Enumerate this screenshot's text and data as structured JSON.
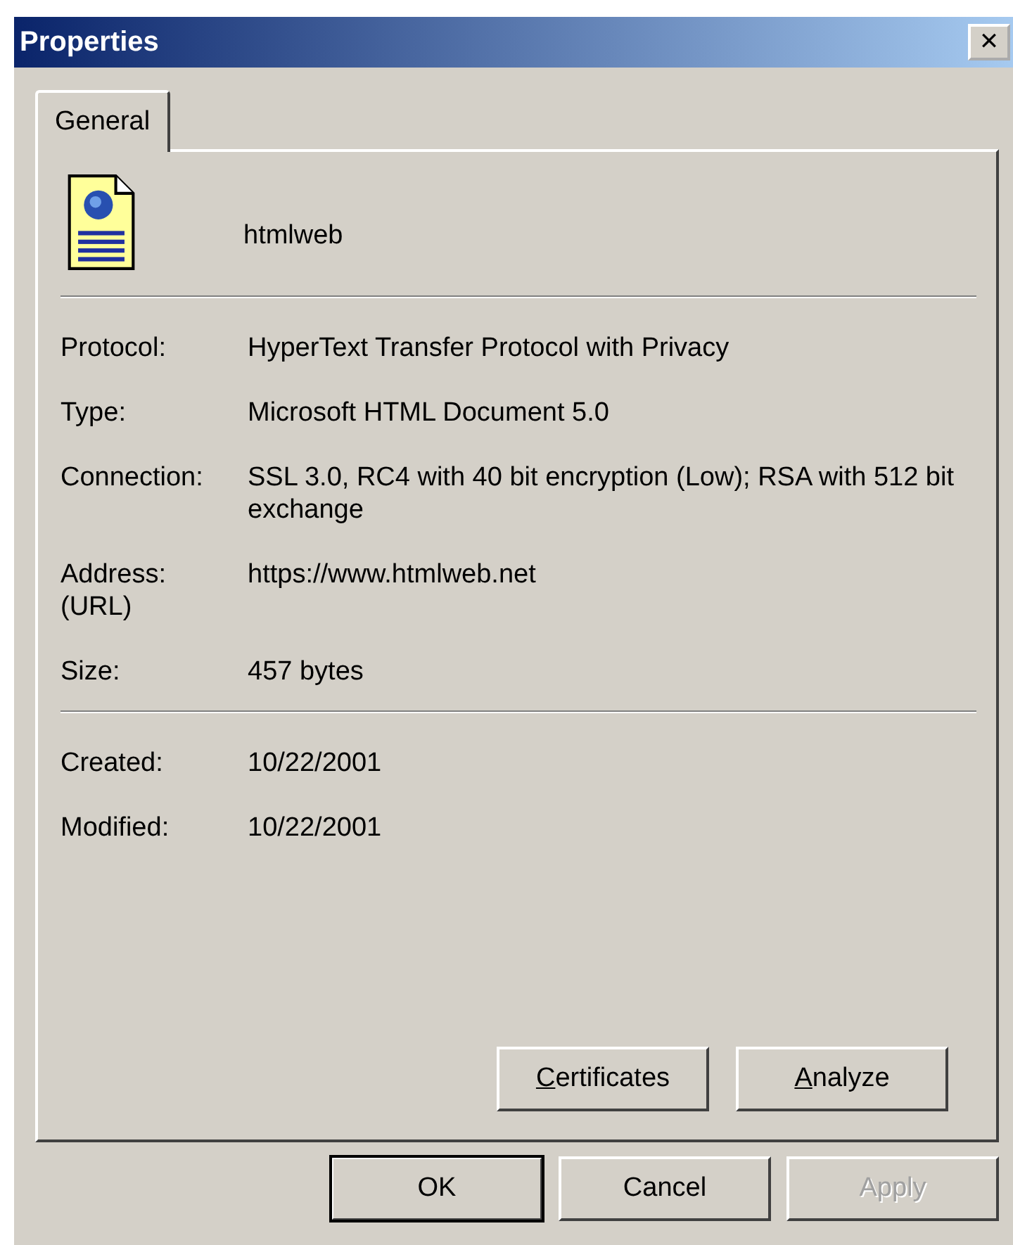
{
  "window": {
    "title": "Properties",
    "close": "✕"
  },
  "tabs": [
    {
      "label": "General",
      "selected": true
    }
  ],
  "file": {
    "name": "htmlweb"
  },
  "sections": [
    {
      "rows": [
        {
          "label": "Protocol:",
          "value": "HyperText Transfer Protocol with Privacy"
        },
        {
          "label": "Type:",
          "value": "Microsoft HTML Document 5.0"
        },
        {
          "label": "Connection:",
          "value": "SSL 3.0, RC4 with 40 bit encryption (Low); RSA with 512 bit exchange"
        },
        {
          "label": "Address:\n(URL)",
          "value": "https://www.htmlweb.net"
        },
        {
          "label": "Size:",
          "value": "457 bytes"
        }
      ]
    },
    {
      "rows": [
        {
          "label": "Created:",
          "value": "10/22/2001"
        },
        {
          "label": "Modified:",
          "value": "10/22/2001"
        }
      ]
    }
  ],
  "panel_buttons": [
    {
      "label": "Certificates",
      "underline_first": true
    },
    {
      "label": "Analyze",
      "underline_first": true
    }
  ],
  "buttons": [
    {
      "label": "OK",
      "default": true,
      "disabled": false
    },
    {
      "label": "Cancel",
      "default": false,
      "disabled": false
    },
    {
      "label": "Apply",
      "default": false,
      "disabled": true
    }
  ]
}
